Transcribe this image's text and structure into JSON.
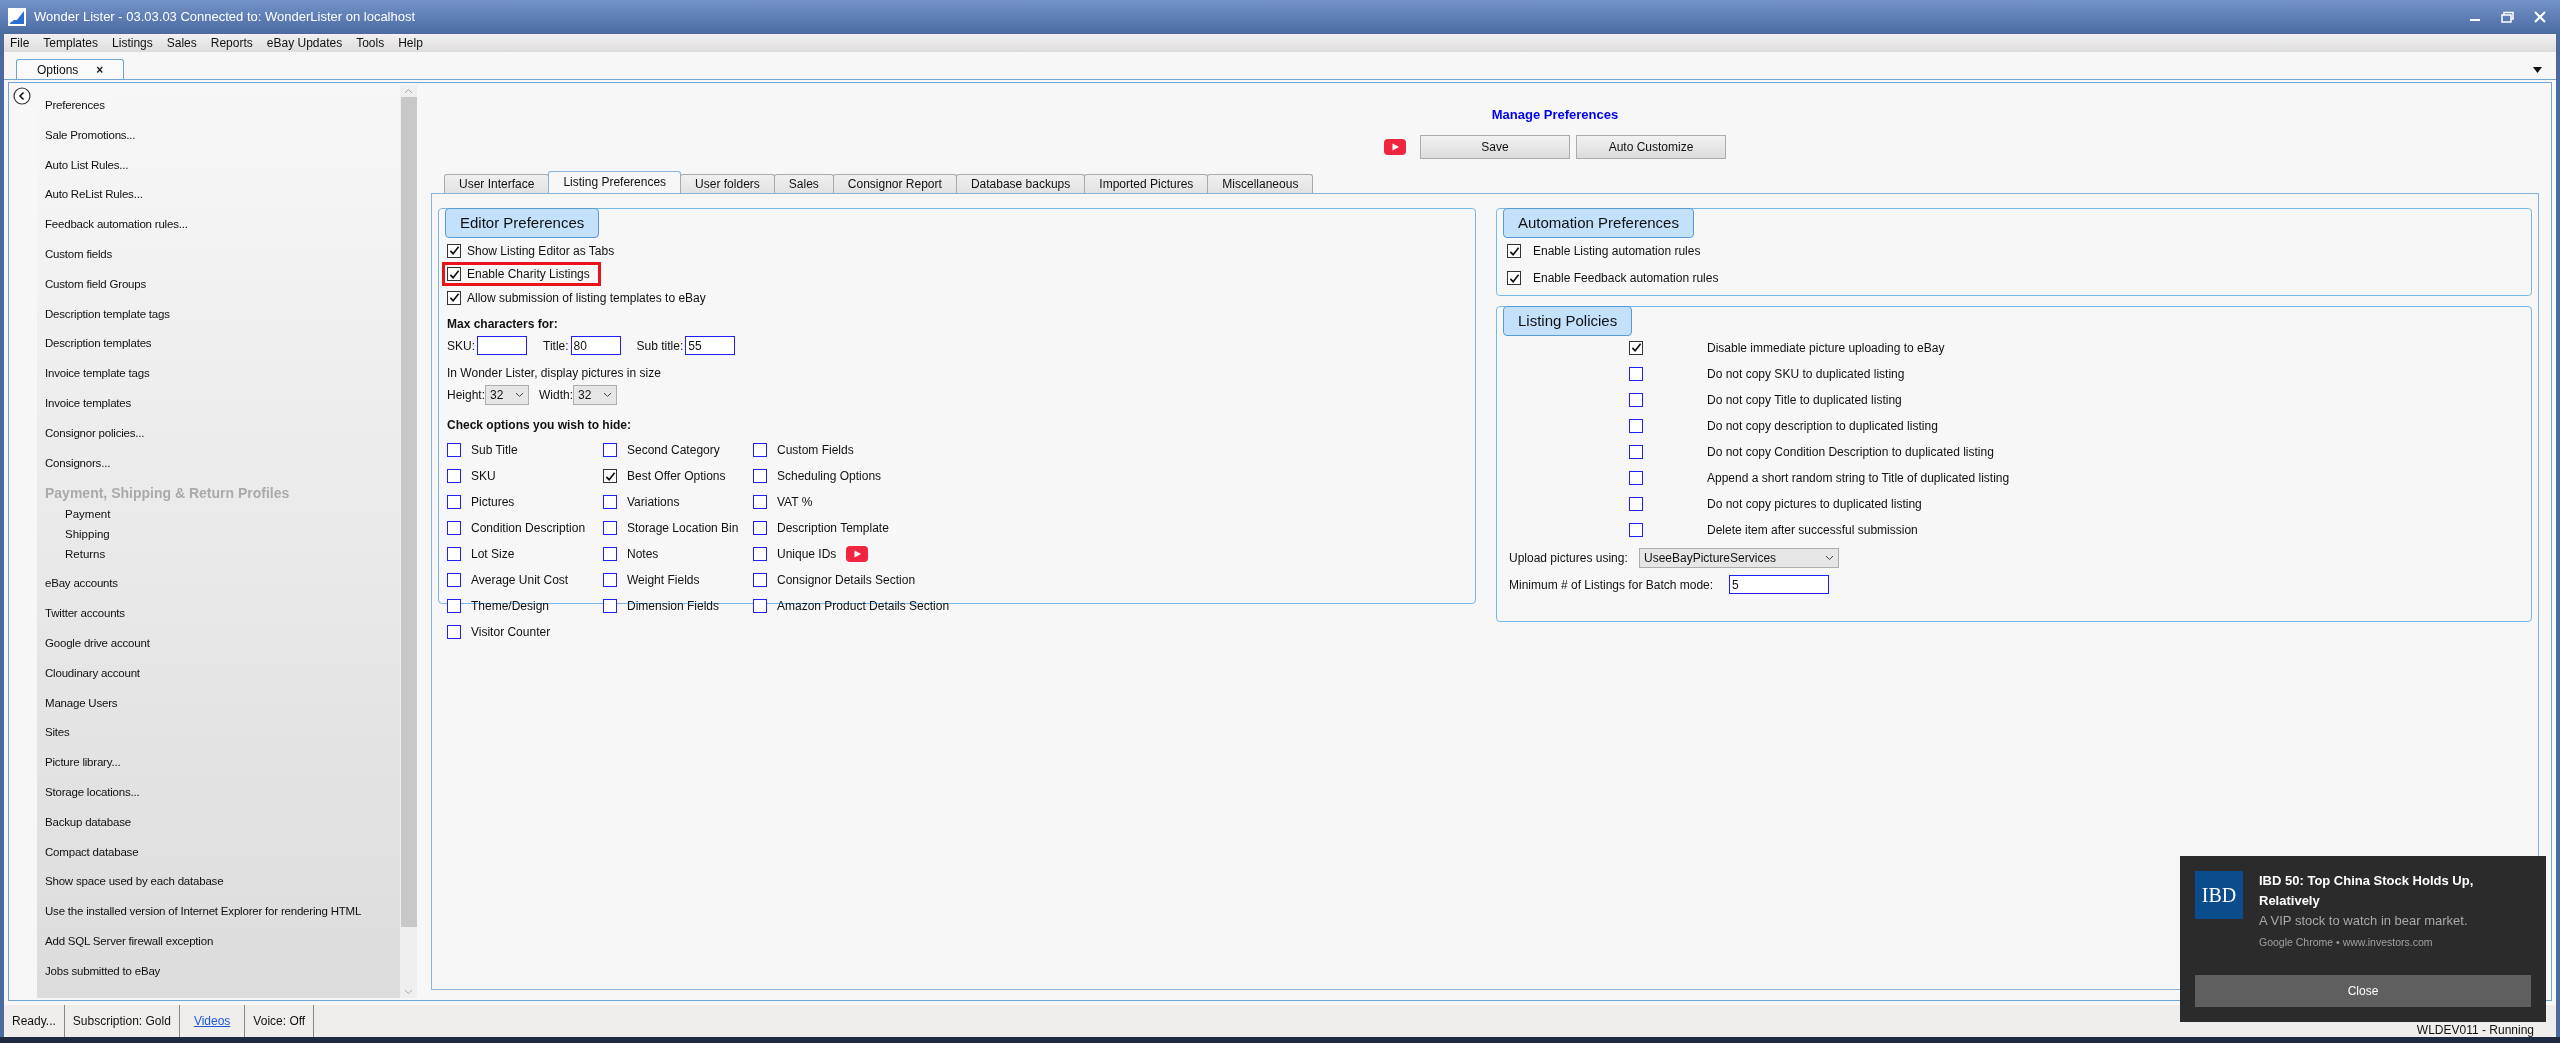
{
  "window": {
    "title": "Wonder Lister - 03.03.03 Connected to: WonderLister on localhost"
  },
  "menu": [
    "File",
    "Templates",
    "Listings",
    "Sales",
    "Reports",
    "eBay Updates",
    "Tools",
    "Help"
  ],
  "doc_tabs": [
    {
      "label": "Options",
      "close": "×",
      "selected": true
    }
  ],
  "sidebar": {
    "items": [
      {
        "kind": "link",
        "label": "Preferences"
      },
      {
        "kind": "link",
        "label": "Sale Promotions..."
      },
      {
        "kind": "link",
        "label": "Auto List Rules..."
      },
      {
        "kind": "link",
        "label": "Auto ReList Rules..."
      },
      {
        "kind": "link",
        "label": "Feedback automation rules..."
      },
      {
        "kind": "link",
        "label": "Custom fields"
      },
      {
        "kind": "link",
        "label": "Custom field Groups"
      },
      {
        "kind": "link",
        "label": "Description template tags"
      },
      {
        "kind": "link",
        "label": "Description templates"
      },
      {
        "kind": "link",
        "label": "Invoice template tags"
      },
      {
        "kind": "link",
        "label": "Invoice templates"
      },
      {
        "kind": "link",
        "label": "Consignor policies..."
      },
      {
        "kind": "link",
        "label": "Consignors..."
      },
      {
        "kind": "heading",
        "label": "Payment, Shipping & Return Profiles",
        "children": [
          {
            "label": "Payment"
          },
          {
            "label": "Shipping"
          },
          {
            "label": "Returns"
          }
        ]
      },
      {
        "kind": "link",
        "label": "eBay accounts"
      },
      {
        "kind": "link",
        "label": "Twitter accounts"
      },
      {
        "kind": "link",
        "label": "Google drive account"
      },
      {
        "kind": "link",
        "label": "Cloudinary account"
      },
      {
        "kind": "link",
        "label": "Manage Users"
      },
      {
        "kind": "link",
        "label": "Sites"
      },
      {
        "kind": "link",
        "label": "Picture library..."
      },
      {
        "kind": "link",
        "label": "Storage locations..."
      },
      {
        "kind": "link",
        "label": "Backup database"
      },
      {
        "kind": "link",
        "label": "Compact database"
      },
      {
        "kind": "link",
        "label": "Show space used by each database"
      },
      {
        "kind": "link",
        "label": "Use the installed version of Internet Explorer for rendering HTML"
      },
      {
        "kind": "link",
        "label": "Add SQL Server firewall exception"
      },
      {
        "kind": "link",
        "label": "Jobs submitted to eBay"
      }
    ]
  },
  "page_title": "Manage Preferences",
  "buttons": [
    "Save",
    "Auto Customize"
  ],
  "tabs": [
    {
      "label": "User Interface",
      "selected": false
    },
    {
      "label": "Listing Preferences",
      "selected": true
    },
    {
      "label": "User folders",
      "selected": false
    },
    {
      "label": "Sales",
      "selected": false
    },
    {
      "label": "Consignor Report",
      "selected": false
    },
    {
      "label": "Database backups",
      "selected": false
    },
    {
      "label": "Imported Pictures",
      "selected": false
    },
    {
      "label": "Miscellaneous",
      "selected": false
    }
  ],
  "editor_preferences": {
    "title": "Editor Preferences",
    "options": [
      {
        "label": "Show Listing Editor as Tabs",
        "checked": true,
        "highlighted": false
      },
      {
        "label": "Enable Charity Listings",
        "checked": true,
        "highlighted": true
      },
      {
        "label": "Allow submission of listing templates to eBay",
        "checked": true,
        "highlighted": false
      }
    ],
    "max_chars_label": "Max characters for:",
    "max_chars": [
      {
        "label": "SKU:"
      },
      {
        "label": "Title:",
        "value": "80"
      },
      {
        "label": "Sub title:",
        "value": "55"
      }
    ],
    "picture_size_label": "In Wonder Lister, display pictures in size",
    "picture_size": [
      {
        "label": "Height:",
        "value": "32"
      },
      {
        "label": "Width:",
        "value": "32"
      }
    ],
    "hide_label": "Check options you wish to hide:",
    "hide_columns": [
      [
        {
          "label": "Sub Title",
          "checked": false,
          "video": false
        },
        {
          "label": "SKU",
          "checked": false,
          "video": false
        },
        {
          "label": "Pictures",
          "checked": false,
          "video": false
        },
        {
          "label": "Condition Description",
          "checked": false,
          "video": false
        },
        {
          "label": "Lot Size",
          "checked": false,
          "video": false
        },
        {
          "label": "Average Unit Cost",
          "checked": false,
          "video": false
        },
        {
          "label": "Theme/Design",
          "checked": false,
          "video": false
        },
        {
          "label": "Visitor Counter",
          "checked": false,
          "video": false
        }
      ],
      [
        {
          "label": "Second Category",
          "checked": false,
          "video": false
        },
        {
          "label": "Best Offer Options",
          "checked": true,
          "video": false
        },
        {
          "label": "Variations",
          "checked": false,
          "video": false
        },
        {
          "label": "Storage Location Bin",
          "checked": false,
          "video": false
        },
        {
          "label": "Notes",
          "checked": false,
          "video": false
        },
        {
          "label": "Weight Fields",
          "checked": false,
          "video": false
        },
        {
          "label": "Dimension Fields",
          "checked": false,
          "video": false
        }
      ],
      [
        {
          "label": "Custom Fields",
          "checked": false,
          "video": false
        },
        {
          "label": "Scheduling Options",
          "checked": false,
          "video": false
        },
        {
          "label": "VAT %",
          "checked": false,
          "video": false
        },
        {
          "label": "Description Template",
          "checked": false,
          "video": false
        },
        {
          "label": "Unique IDs",
          "checked": false,
          "video": true
        },
        {
          "label": "Consignor Details Section",
          "checked": false,
          "video": false
        },
        {
          "label": "Amazon Product Details Section",
          "checked": false,
          "video": false
        }
      ]
    ]
  },
  "automation_preferences": {
    "title": "Automation Preferences",
    "options": [
      {
        "label": "Enable Listing automation rules",
        "checked": true
      },
      {
        "label": "Enable Feedback automation rules",
        "checked": true
      }
    ]
  },
  "listing_policies": {
    "title": "Listing Policies",
    "options": [
      {
        "label": "Disable immediate picture uploading to eBay",
        "checked": true
      },
      {
        "label": "Do not copy SKU to duplicated listing",
        "checked": false
      },
      {
        "label": "Do not copy Title to duplicated listing",
        "checked": false
      },
      {
        "label": "Do not copy description to duplicated listing",
        "checked": false
      },
      {
        "label": "Do not copy Condition Description to duplicated listing",
        "checked": false
      },
      {
        "label": "Append a short random string to Title of duplicated listing",
        "checked": false
      },
      {
        "label": "Do not copy pictures to duplicated listing",
        "checked": false
      },
      {
        "label": "Delete item after successful submission",
        "checked": false
      }
    ],
    "upload_label": "Upload pictures using:",
    "upload_value": "UseeBayPictureServices",
    "batch_label": "Minimum # of Listings for Batch mode:",
    "batch_value": "5"
  },
  "status_bar": [
    {
      "kind": "text",
      "label": "Ready..."
    },
    {
      "kind": "text",
      "label": "Subscription: Gold"
    },
    {
      "kind": "link",
      "label": "Videos"
    },
    {
      "kind": "text",
      "label": "Voice:  Off"
    }
  ],
  "status_right": "WLDEV011 - Running",
  "notification": {
    "logo": "IBD",
    "title": "IBD 50: Top China Stock Holds Up, Relatively",
    "body": "A VIP stock to watch in bear market.",
    "source": "Google Chrome • www.investors.com",
    "button": "Close"
  }
}
